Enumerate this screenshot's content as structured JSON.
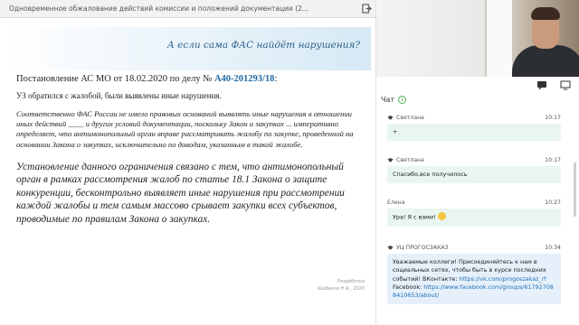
{
  "window": {
    "title": "Одновременное обжалование действий комиссии и положений документации (2..."
  },
  "slide": {
    "title": "А если сама ФАС найдёт нарушения?",
    "line1_prefix": "Постановление АС МО от 18.02.2020 по делу № ",
    "line1_link": "А40-201293/18",
    "line1_suffix": ":",
    "line2": "УЗ обратился с жалобой, были выявлены иные нарушения.",
    "quote": "Соответственно ФАС России не имело правовых оснований выявлять иные нарушения в отношении иных действий ____ и других условий документации, поскольку Закон о закупках ... императивно определяет, что антимонопольный орган вправе рассматривать жалобу по закупке, проведенной на основании Закона о закупках, исключительно по доводам, указанным в такой жалобе.",
    "conclusion": "Установление данного ограничения связано с тем, что антимонопольный орган в рамках рассмотрения жалоб по статье 18.1 Закона о защите конкуренции, бесконтрольно выявляет иные нарушения при рассмотрении каждой жалобы и тем самым массово срывает закупки всех субъектов, проводимые по правилам Закона о закупках.",
    "credit_line1": "Разработка",
    "credit_line2": "Шибанов Н.А., 2020"
  },
  "chat": {
    "label": "Чат",
    "messages": [
      {
        "author": "Светлана",
        "time": "10:17",
        "text": "+"
      },
      {
        "author": "Светлана",
        "time": "10:17",
        "text": "Спасибо,все получилось"
      },
      {
        "author": "Елена",
        "time": "10:27",
        "text": "Ура! Я с вами!"
      },
      {
        "author": "УЦ ПРОГОСЗАКАЗ",
        "time": "10:34",
        "text": "Уважаемые коллеги! Присоединяйтесь к нам в социальных сетях, чтобы быть в курсе последних событий! ВКонтакте: ",
        "link1": "https://vk.com/progoszakaz_rf",
        "mid": " Facebook: ",
        "link2": "https://www.facebook.com/groups/617927088410653/about/"
      }
    ]
  },
  "icons": {
    "exit": "exit-icon",
    "chat_toggle": "chat-bubble-icon",
    "screen": "screen-icon",
    "download": "download-icon",
    "author_role": "graduation-cap-icon"
  },
  "colors": {
    "accent": "#2a5d8a",
    "link": "#1f6aa5",
    "msg_green": "#e8f6ef",
    "msg_blue": "#e5f0fa"
  }
}
